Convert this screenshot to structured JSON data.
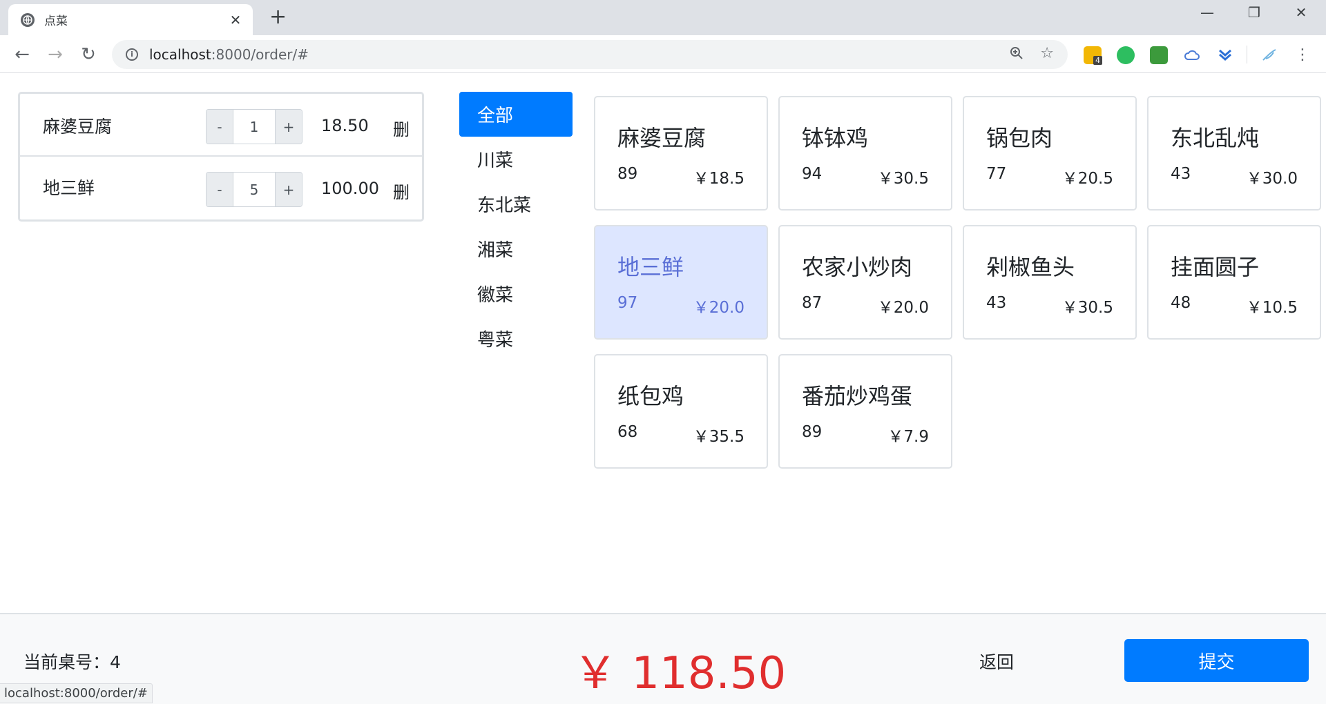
{
  "browser": {
    "tab_title": "点菜",
    "url_host": "localhost",
    "url_rest": ":8000/order/#",
    "ext_badge": "4",
    "status_url": "localhost:8000/order/#"
  },
  "cart": {
    "delete_label": "删",
    "items": [
      {
        "name": "麻婆豆腐",
        "qty": "1",
        "subtotal": "18.50"
      },
      {
        "name": "地三鲜",
        "qty": "5",
        "subtotal": "100.00"
      }
    ]
  },
  "categories": [
    "全部",
    "川菜",
    "东北菜",
    "湘菜",
    "徽菜",
    "粤菜"
  ],
  "dishes": [
    {
      "name": "麻婆豆腐",
      "sales": "89",
      "price": "￥18.5"
    },
    {
      "name": "钵钵鸡",
      "sales": "94",
      "price": "￥30.5"
    },
    {
      "name": "锅包肉",
      "sales": "77",
      "price": "￥20.5"
    },
    {
      "name": "东北乱炖",
      "sales": "43",
      "price": "￥30.0"
    },
    {
      "name": "地三鲜",
      "sales": "97",
      "price": "￥20.0"
    },
    {
      "name": "农家小炒肉",
      "sales": "87",
      "price": "￥20.0"
    },
    {
      "name": "剁椒鱼头",
      "sales": "43",
      "price": "￥30.5"
    },
    {
      "name": "挂面圆子",
      "sales": "48",
      "price": "￥10.5"
    },
    {
      "name": "纸包鸡",
      "sales": "68",
      "price": "￥35.5"
    },
    {
      "name": "番茄炒鸡蛋",
      "sales": "89",
      "price": "￥7.9"
    }
  ],
  "footer": {
    "table_label": "当前桌号：4",
    "total": "￥ 118.50",
    "back_label": "返回",
    "submit_label": "提交"
  },
  "colors": {
    "accent": "#007bff",
    "total": "#e02e2e",
    "selected_card": "#dde6ff"
  }
}
